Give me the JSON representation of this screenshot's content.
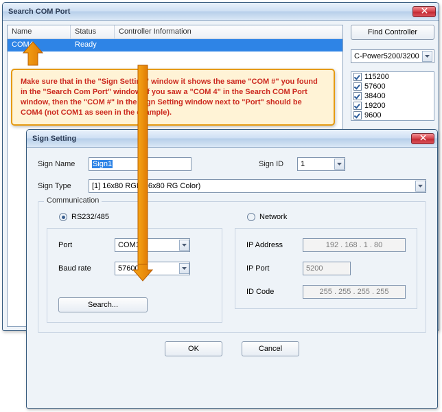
{
  "search_window": {
    "title": "Search COM Port",
    "columns": {
      "name": "Name",
      "status": "Status",
      "info": "Controller Information"
    },
    "row": {
      "name": "COM4",
      "status": "Ready",
      "info": ""
    },
    "find_button": "Find Controller",
    "controller_combo": "C-Power5200/3200",
    "baud_rates": [
      "115200",
      "57600",
      "38400",
      "19200",
      "9600"
    ]
  },
  "callout_text": "Make sure that in the \"Sign Setting\" window it shows the same \"COM #\" you found in the \"Search Com Port\" window. If you saw a \"COM 4\" in the Search COM Port window, then the \"COM #\" in the Sign Setting window next to \"Port\" should be COM4 (not COM1 as seen in the example).",
  "sign_window": {
    "title": "Sign Setting",
    "labels": {
      "sign_name": "Sign Name",
      "sign_id": "Sign ID",
      "sign_type": "Sign Type",
      "communication": "Communication",
      "rs232": "RS232/485",
      "network": "Network",
      "port": "Port",
      "baud": "Baud rate",
      "search": "Search...",
      "ip_addr": "IP Address",
      "ip_port": "IP Port",
      "id_code": "ID Code",
      "ok": "OK",
      "cancel": "Cancel"
    },
    "values": {
      "sign_name": "Sign1",
      "sign_id": "1",
      "sign_type": "[1] 16x80 RGB(16x80 RG Color)",
      "port": "COM1",
      "baud": "57600",
      "ip_addr": "192 . 168 .  1  .  80",
      "ip_port": "5200",
      "id_code": "255 . 255 . 255 . 255"
    }
  }
}
